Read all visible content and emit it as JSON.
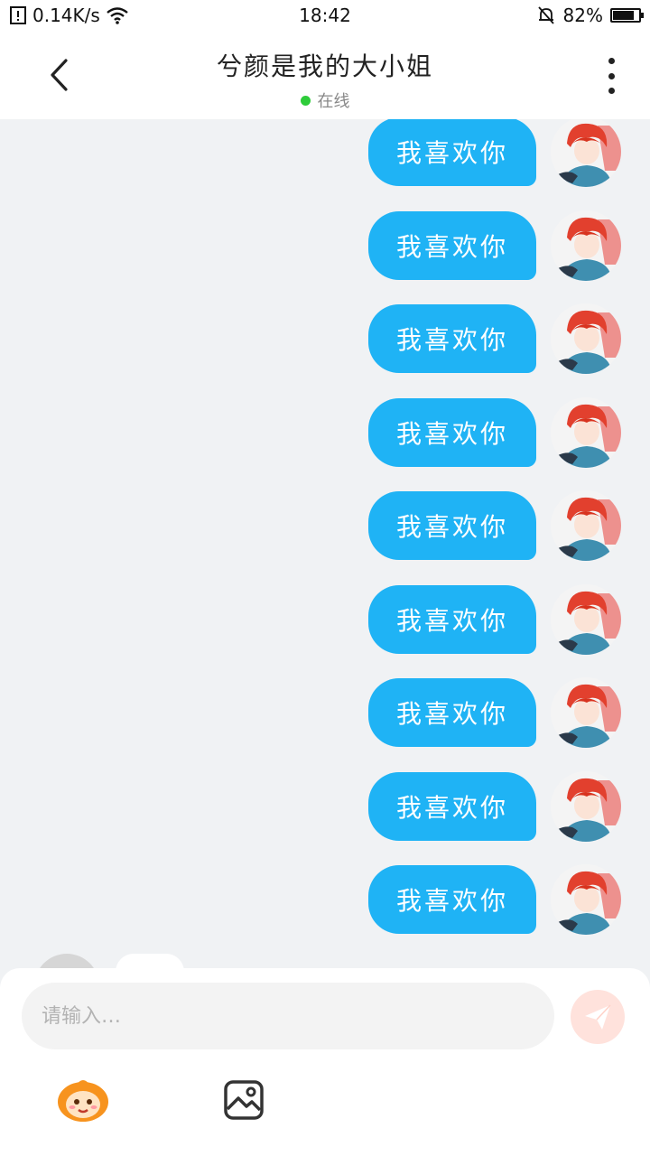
{
  "status_bar": {
    "network_speed": "0.14K/s",
    "time": "18:42",
    "battery_percent": "82%",
    "battery_level": 0.82
  },
  "header": {
    "title": "兮颜是我的大小姐",
    "status": "在线",
    "status_color": "#2ecc3a"
  },
  "messages": [
    {
      "text": "我喜欢你"
    },
    {
      "text": "我喜欢你"
    },
    {
      "text": "我喜欢你"
    },
    {
      "text": "我喜欢你"
    },
    {
      "text": "我喜欢你"
    },
    {
      "text": "我喜欢你"
    },
    {
      "text": "我喜欢你"
    },
    {
      "text": "我喜欢你"
    },
    {
      "text": "我喜欢你"
    }
  ],
  "composer": {
    "placeholder": "请输入…"
  },
  "colors": {
    "bubble": "#1fb3f5",
    "send_button": "#ffe2dc",
    "background": "#f0f2f4"
  },
  "icons": {
    "back": "chevron-left-icon",
    "more": "more-vertical-icon",
    "send": "send-icon",
    "emoji": "emoji-sticker-icon",
    "image": "image-icon"
  }
}
